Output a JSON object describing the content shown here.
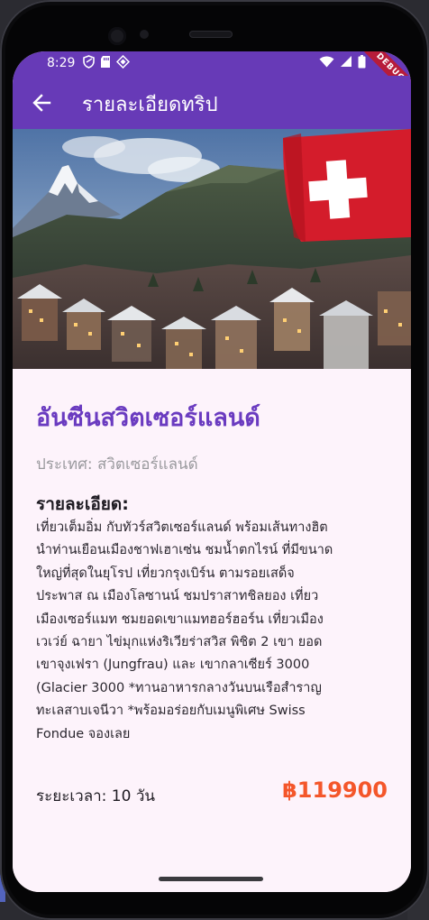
{
  "status_bar": {
    "time": "8:29",
    "left_icons": [
      "shield-icon",
      "sd-card-icon",
      "diamond-icon"
    ],
    "right_icons": [
      "wifi-icon",
      "signal-icon",
      "battery-icon"
    ],
    "debug_label": "DEBUG"
  },
  "app_bar": {
    "back_icon": "arrow-left-icon",
    "title": "รายละเอียดทริป"
  },
  "trip": {
    "name": "อันซีนสวิตเซอร์แลนด์",
    "country": "ประเทศ: สวิตเซอร์แลนด์",
    "detail_heading": "รายละเอียด:",
    "description": "เที่ยวเต็มอิ่ม กับทัวร์สวิตเซอร์แลนด์ พร้อมเส้นทางฮิต\nนำท่านเยือนเมืองชาฟเฮาเซ่น ชมน้ำตกไรน์ ที่มีขนาด\nใหญ่ที่สุดในยุโรป เที่ยวกรุงเบิร์น ตามรอยเสด็จ\nประพาส ณ เมืองโลซานน์ ชมปราสาทชิลยอง เที่ยว\nเมืองเซอร์แมท ชมยอดเขาแมทฮอร์ฮอร์น เที่ยวเมือง\nเวเว่ย์ ฉายา ไข่มุกแห่งริเวียร่าสวิส พิชิต 2 เขา ยอด\nเขาจุงเฟรา (Jungfrau) และ เขากลาเซียร์ 3000\n(Glacier 3000 *ทานอาหารกลางวันบนเรือสำราญ\nทะเลสาบเจนีวา *พร้อมอร่อยกับเมนูพิเศษ Swiss\nFondue จองเลย",
    "duration": "ระยะเวลา: 10 วัน",
    "price": "฿119900"
  },
  "colors": {
    "primary": "#673ab7",
    "title_purple": "#6a3bc0",
    "price_orange": "#f4562a",
    "background": "#fdf3fb"
  }
}
